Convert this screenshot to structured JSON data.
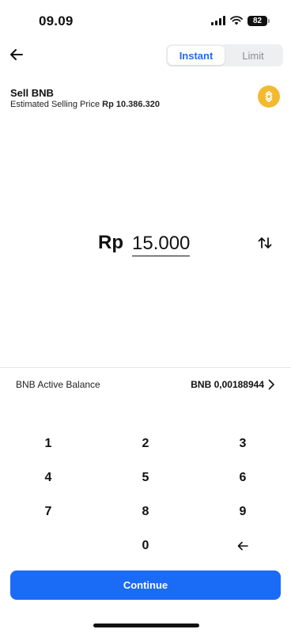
{
  "status_bar": {
    "time": "09.09",
    "battery": "82",
    "icons": [
      "signal-icon",
      "wifi-icon",
      "battery-icon"
    ]
  },
  "header": {
    "back_icon": "arrow-left-icon",
    "tabs": [
      {
        "label": "Instant",
        "active": true
      },
      {
        "label": "Limit",
        "active": false
      }
    ]
  },
  "asset": {
    "title": "Sell BNB",
    "price_label": "Estimated Selling Price",
    "price_value": "Rp 10.386.320",
    "coin_icon": "bnb-coin-icon"
  },
  "amount": {
    "currency": "Rp",
    "value": "15.000",
    "swap_icon": "swap-vertical-icon"
  },
  "balance": {
    "label": "BNB Active Balance",
    "value": "BNB 0,00188944",
    "chevron_icon": "chevron-right-icon"
  },
  "keypad": {
    "keys": [
      "1",
      "2",
      "3",
      "4",
      "5",
      "6",
      "7",
      "8",
      "9",
      "",
      "0"
    ],
    "backspace_icon": "backspace-arrow-icon"
  },
  "continue": {
    "label": "Continue"
  },
  "colors": {
    "accent": "#1a6bf6",
    "tab_active_text": "#1e6cf5",
    "coin": "#f3ba2f"
  }
}
